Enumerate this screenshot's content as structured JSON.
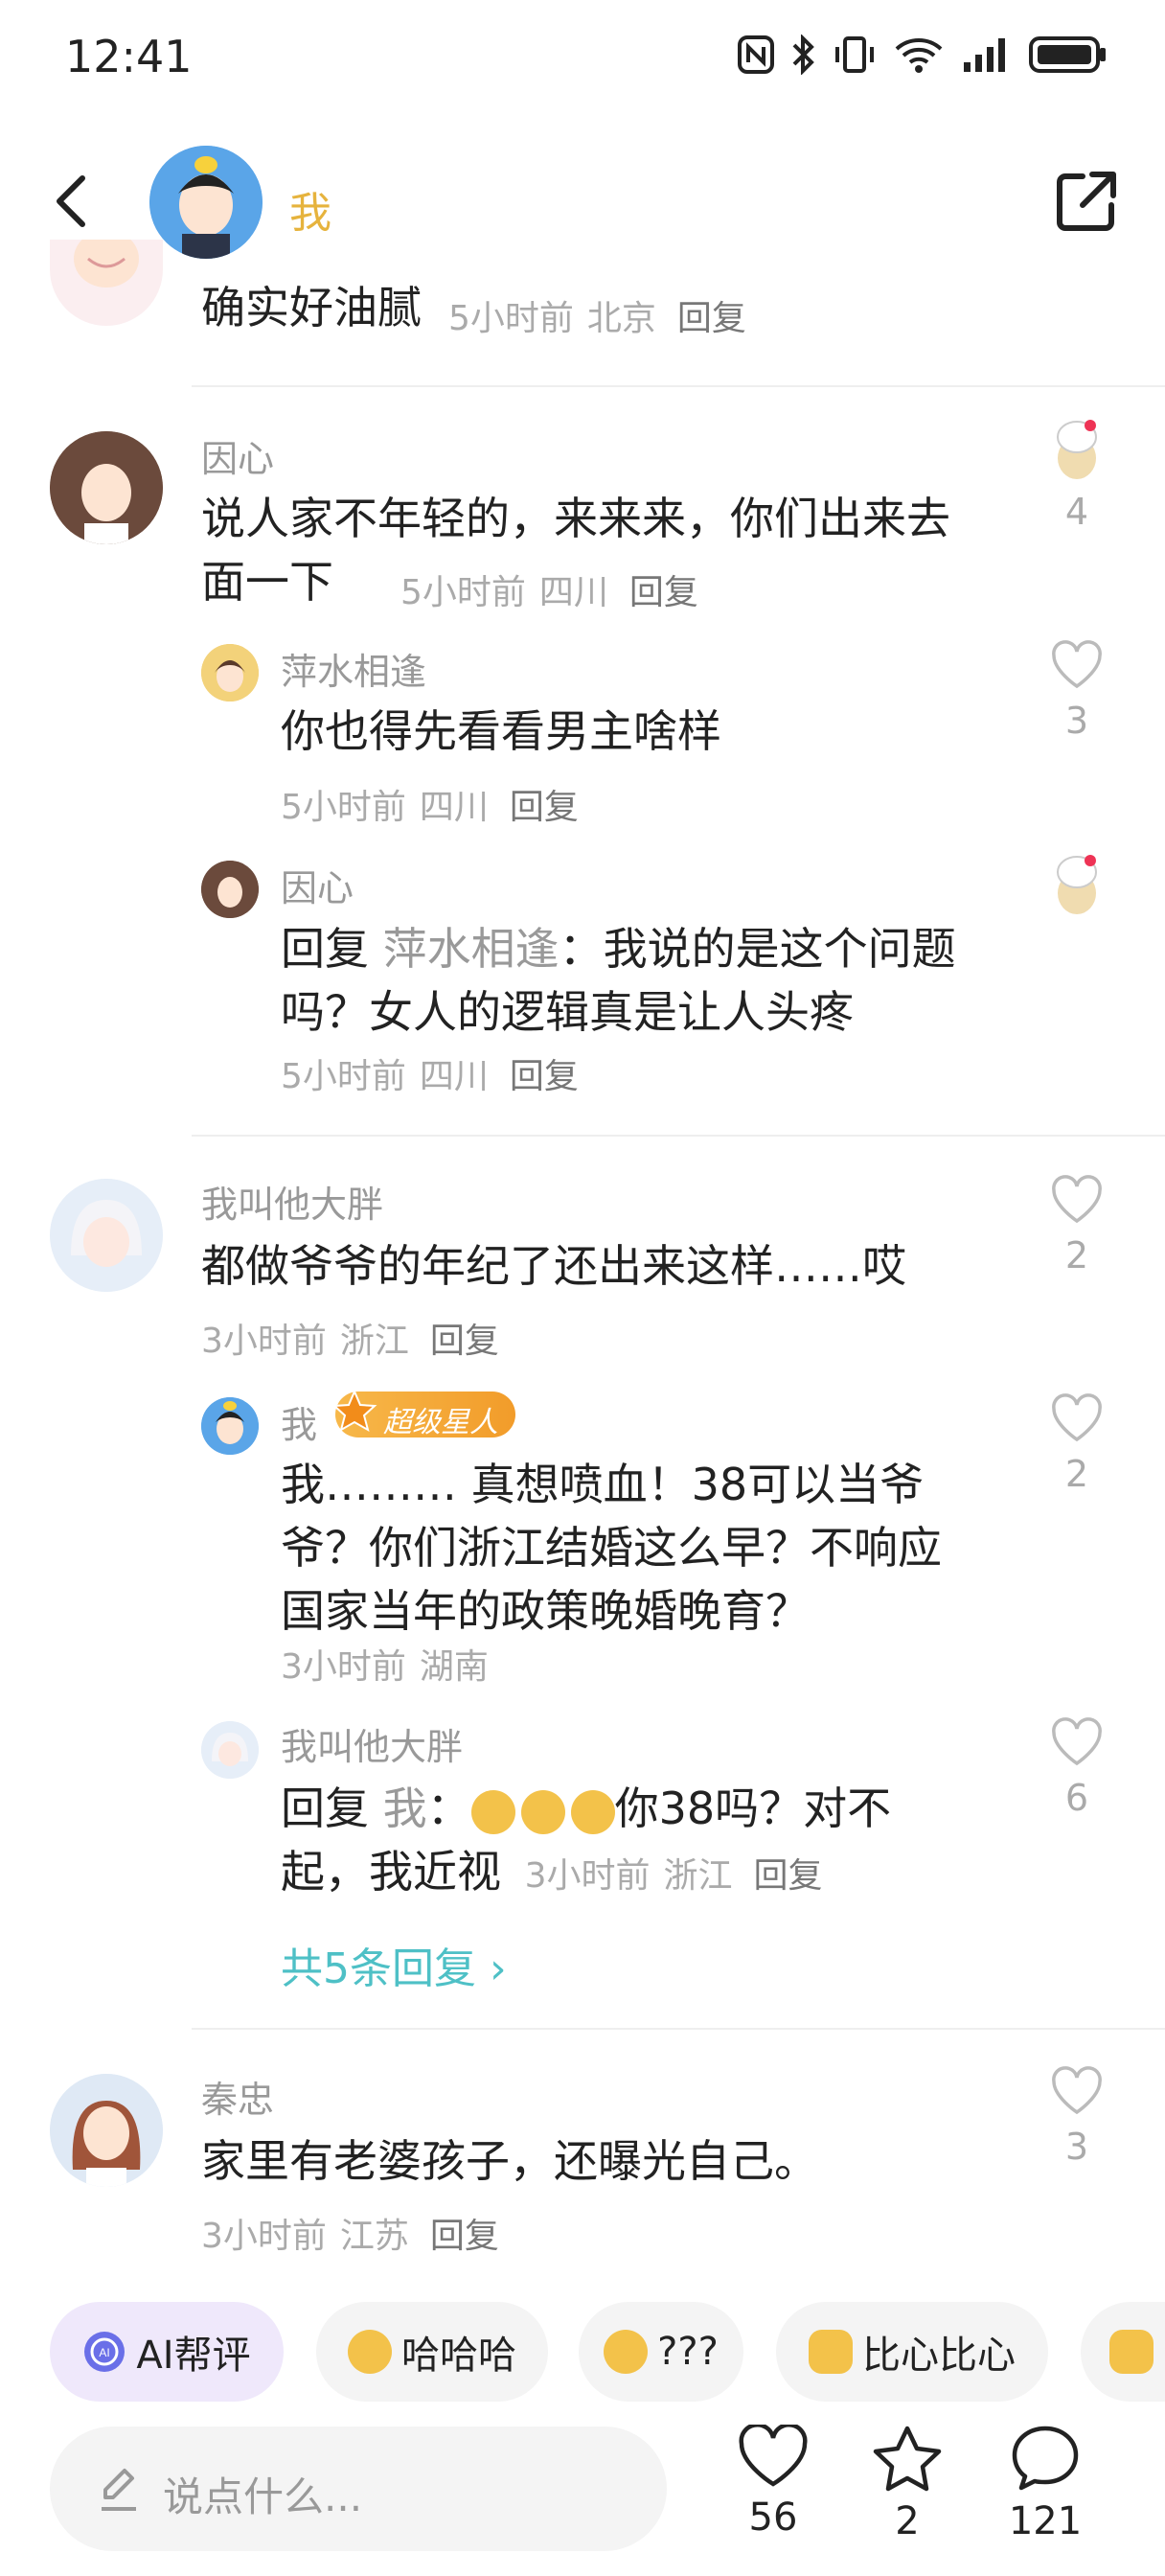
{
  "status_bar": {
    "time": "12:41"
  },
  "header": {
    "title": "我"
  },
  "comments": [
    {
      "name": "",
      "text": "确实好油腻",
      "time": "5小时前",
      "loc": "北京",
      "reply": "回复"
    },
    {
      "name": "因心",
      "text": "说人家不年轻的，来来来，你们出来去面一下",
      "time": "5小时前",
      "loc": "四川",
      "reply": "回复",
      "likes": "4",
      "replies": [
        {
          "name": "萍水相逢",
          "text": "你也得先看看男主啥样",
          "time": "5小时前",
          "loc": "四川",
          "reply": "回复",
          "likes": "3"
        },
        {
          "name": "因心",
          "reply_prefix": "回复",
          "reply_to": "萍水相逢",
          "text": "：我说的是这个问题吗？女人的逻辑真是让人头疼",
          "time": "5小时前",
          "loc": "四川",
          "reply": "回复"
        }
      ]
    },
    {
      "name": "我叫他大胖",
      "text": "都做爷爷的年纪了还出来这样……哎",
      "time": "3小时前",
      "loc": "浙江",
      "reply": "回复",
      "likes": "2",
      "replies": [
        {
          "name": "我",
          "badge": "超级星人",
          "text": "我……… 真想喷血！38可以当爷爷？你们浙江结婚这么早？不响应国家当年的政策晚婚晚育？",
          "time": "3小时前",
          "loc": "湖南",
          "reply": "回复",
          "likes": "2"
        },
        {
          "name": "我叫他大胖",
          "reply_prefix": "回复",
          "reply_to": "我",
          "text": "你38吗？对不起，我近视",
          "time": "3小时前",
          "loc": "浙江",
          "reply": "回复",
          "likes": "6"
        }
      ],
      "more": "共5条回复 ›"
    },
    {
      "name": "秦忠",
      "text": "家里有老婆孩子，还曝光自己。",
      "time": "3小时前",
      "loc": "江苏",
      "reply": "回复",
      "likes": "3"
    }
  ],
  "chips": [
    "AI帮评",
    "哈哈哈",
    "???",
    "比心比心"
  ],
  "bottom": {
    "placeholder": "说点什么...",
    "likes": "56",
    "stars": "2",
    "comments": "121"
  },
  "colors": {
    "accent_name": "#e6b33d",
    "more_link": "#4ec0c6"
  }
}
